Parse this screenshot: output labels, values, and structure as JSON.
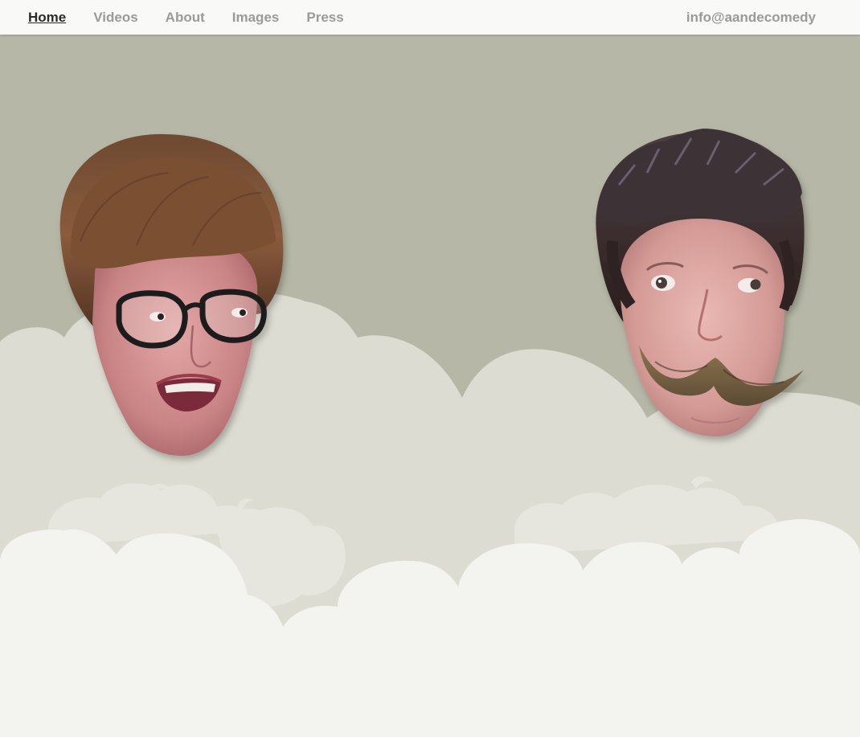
{
  "nav": {
    "links": [
      {
        "label": "Home",
        "active": true
      },
      {
        "label": "Videos",
        "active": false
      },
      {
        "label": "About",
        "active": false
      },
      {
        "label": "Images",
        "active": false
      },
      {
        "label": "Press",
        "active": false
      }
    ],
    "email": "info@aandecomedy"
  },
  "colors": {
    "background": "#b6b7a6",
    "cloud_back": "#dcdcd2",
    "cloud_mid": "#e6e6de",
    "cloud_front": "#f3f3f0",
    "nav_bg": "#f9f9f8",
    "nav_text": "#9a9a9a",
    "nav_active": "#2a2a2a"
  },
  "scene": {
    "characters": [
      {
        "name": "left-character",
        "features": [
          "brown-bob-wig",
          "black-glasses",
          "open-smile"
        ]
      },
      {
        "name": "right-character",
        "features": [
          "spiky-dark-hair",
          "handlebar-mustache",
          "side-glance"
        ]
      }
    ]
  }
}
